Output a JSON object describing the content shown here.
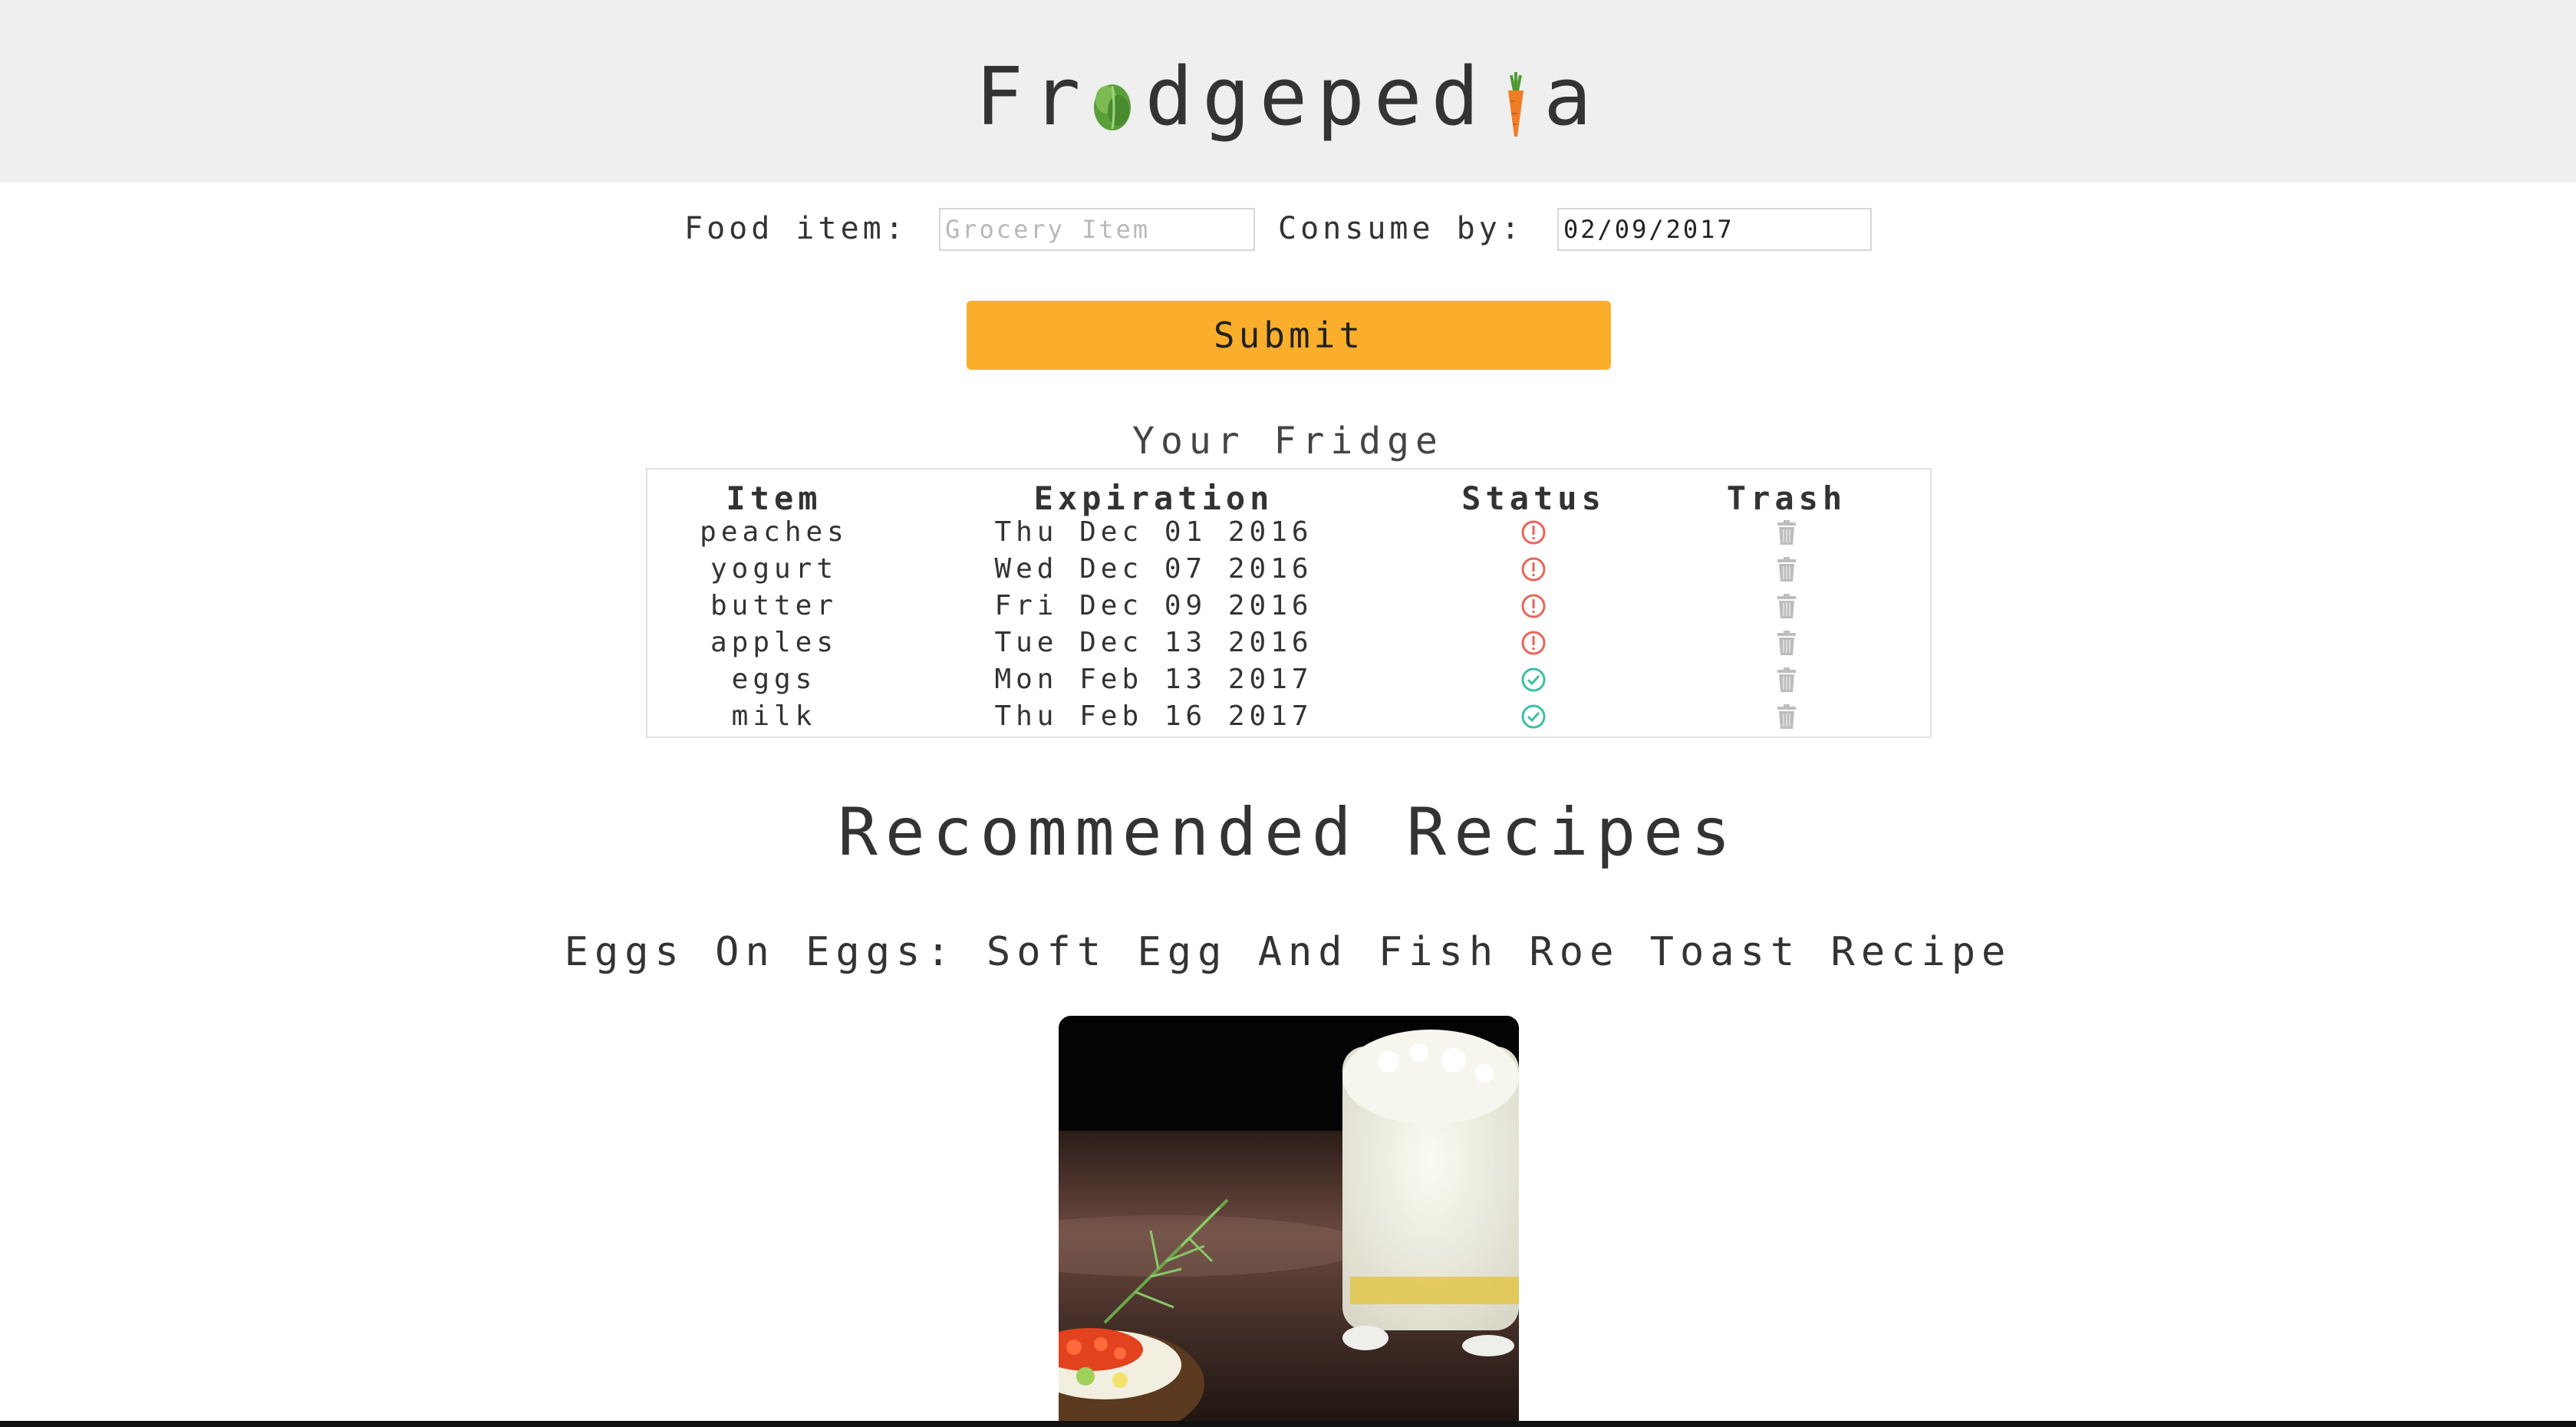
{
  "header": {
    "logo_part1": "Fr",
    "logo_part2": "dgeped",
    "logo_part3": "a",
    "logo_bg": "#efefef"
  },
  "form": {
    "food_label": "Food item:",
    "food_placeholder": "Grocery Item",
    "food_value": "",
    "consume_label": "Consume by:",
    "consume_value": "02/09/2017",
    "submit_label": "Submit",
    "submit_color": "#fbae2c"
  },
  "fridge": {
    "title": "Your Fridge",
    "headers": {
      "item": "Item",
      "expiration": "Expiration",
      "status": "Status",
      "trash": "Trash"
    },
    "rows": [
      {
        "item": "peaches",
        "expiration": "Thu Dec 01 2016",
        "status": "expired",
        "status_icon": "alert-circle-icon",
        "trash_icon": "trash-icon"
      },
      {
        "item": "yogurt",
        "expiration": "Wed Dec 07 2016",
        "status": "expired",
        "status_icon": "alert-circle-icon",
        "trash_icon": "trash-icon"
      },
      {
        "item": "butter",
        "expiration": "Fri Dec 09 2016",
        "status": "expired",
        "status_icon": "alert-circle-icon",
        "trash_icon": "trash-icon"
      },
      {
        "item": "apples",
        "expiration": "Tue Dec 13 2016",
        "status": "expired",
        "status_icon": "alert-circle-icon",
        "trash_icon": "trash-icon"
      },
      {
        "item": "eggs",
        "expiration": "Mon Feb 13 2017",
        "status": "fresh",
        "status_icon": "check-circle-icon",
        "trash_icon": "trash-icon"
      },
      {
        "item": "milk",
        "expiration": "Thu Feb 16 2017",
        "status": "fresh",
        "status_icon": "check-circle-icon",
        "trash_icon": "trash-icon"
      }
    ],
    "colors": {
      "expired": "#e8655a",
      "fresh": "#3dbfa6",
      "trash": "#bdbdbd"
    }
  },
  "recipes": {
    "title": "Recommended Recipes",
    "items": [
      {
        "name": "Eggs On Eggs: Soft Egg And Fish Roe Toast Recipe",
        "image_icon": "recipe-photo"
      }
    ]
  }
}
